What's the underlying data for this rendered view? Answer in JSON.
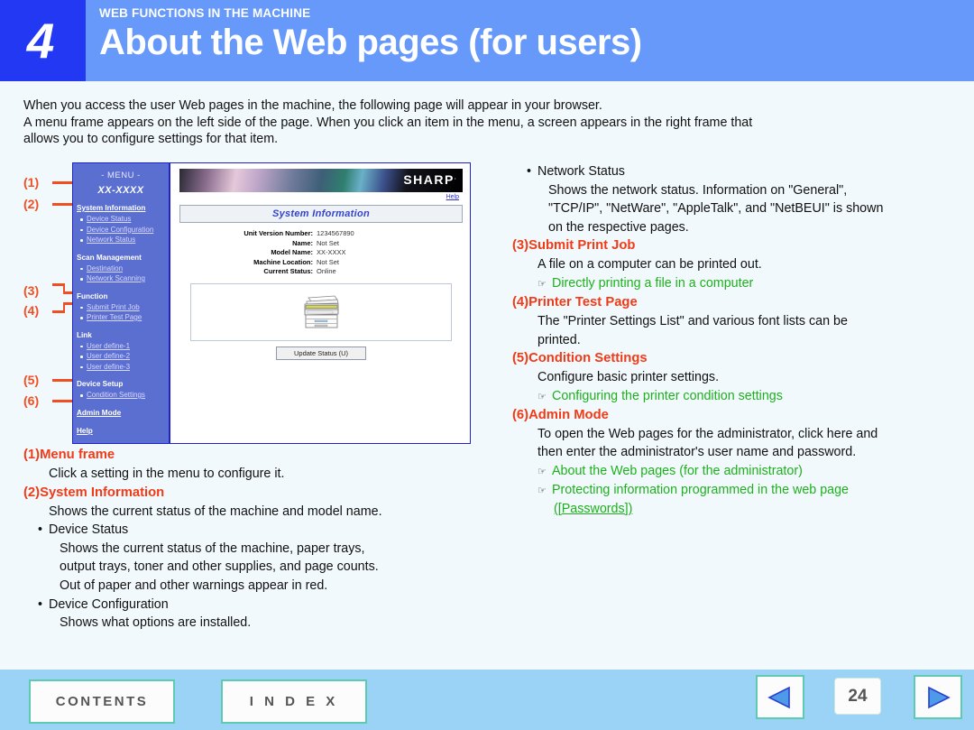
{
  "header": {
    "chapter_number": "4",
    "kicker": "WEB FUNCTIONS IN THE MACHINE",
    "title": "About the Web pages (for users)",
    "chapter_block_color": "#2338f2",
    "banner_color": "#6699fa"
  },
  "intro": {
    "line1": "When you access the user Web pages in the machine, the following page will appear in your browser.",
    "line2": "A menu frame appears on the left side of the page. When you click an item in the menu, a screen appears in the right frame that",
    "line3": "allows you to configure settings for that item."
  },
  "callouts": [
    {
      "label": "(1)"
    },
    {
      "label": "(2)"
    },
    {
      "label": "(3)"
    },
    {
      "label": "(4)"
    },
    {
      "label": "(5)"
    },
    {
      "label": "(6)"
    }
  ],
  "mockup": {
    "menu": {
      "title": "- MENU -",
      "model": "XX-XXXX",
      "groups": [
        {
          "head": "System Information",
          "head_is_link": true,
          "links": [
            "Device Status",
            "Device Configuration",
            "Network Status"
          ]
        },
        {
          "head": "Scan Management",
          "head_is_link": false,
          "links": [
            "Destination",
            "Network Scanning"
          ]
        },
        {
          "head": "Function",
          "head_is_link": false,
          "links": [
            "Submit Print Job",
            "Printer Test Page"
          ]
        },
        {
          "head": "Link",
          "head_is_link": false,
          "links": [
            "User define-1",
            "User define-2",
            "User define-3"
          ]
        },
        {
          "head": "Device Setup",
          "head_is_link": false,
          "links": [
            "Condition Settings"
          ]
        }
      ],
      "admin_mode": "Admin Mode",
      "help": "Help"
    },
    "main": {
      "brand": "SHARP",
      "brand_mark": ".",
      "help_link": "Help",
      "panel_title": "System Information",
      "fields": [
        {
          "label": "Unit Version Number:",
          "value": "1234567890"
        },
        {
          "label": "Name:",
          "value": "Not Set"
        },
        {
          "label": "Model Name:",
          "value": "XX-XXXX"
        },
        {
          "label": "Machine Location:",
          "value": "Not Set"
        },
        {
          "label": "Current Status:",
          "value": "Online"
        }
      ],
      "printer_icon": "multifunction-printer-icon",
      "update_button": "Update Status (U)"
    }
  },
  "left_body": {
    "s1_heading": "(1)Menu frame",
    "s1_text": "Click a setting in the menu to configure it.",
    "s2_heading": "(2)System Information",
    "s2_text": "Shows the current status of the machine and model name.",
    "s2_b1_title": "Device Status",
    "s2_b1_l1": "Shows the current status of the machine, paper trays,",
    "s2_b1_l2": "output trays, toner and other supplies, and page counts.",
    "s2_b1_l3": "Out of paper and other warnings appear in red.",
    "s2_b2_title": "Device Configuration",
    "s2_b2_l1": "Shows what options are installed."
  },
  "right_body": {
    "b3_title": "Network Status",
    "b3_l1": "Shows the network status. Information on \"General\",",
    "b3_l2": "\"TCP/IP\", \"NetWare\", \"AppleTalk\", and \"NetBEUI\" is shown",
    "b3_l3": "on the respective pages.",
    "s3_heading": "(3)Submit Print Job",
    "s3_text": "A file on a computer can be printed out.",
    "s3_link": "Directly printing a file in a computer",
    "s4_heading": "(4)Printer Test Page",
    "s4_l1": "The \"Printer Settings List\" and various font lists can be",
    "s4_l2": "printed.",
    "s5_heading": "(5)Condition Settings",
    "s5_text": "Configure basic printer settings.",
    "s5_link": "Configuring the printer condition settings",
    "s6_heading": "(6)Admin Mode",
    "s6_l1": "To open the Web pages for the administrator, click here and",
    "s6_l2": "then enter the administrator's user name and password.",
    "s6_link1": "About the Web pages (for the administrator)",
    "s6_link2": "Protecting information programmed in the web page ",
    "s6_link2_cont": "([Passwords])"
  },
  "footer": {
    "contents_label": "CONTENTS",
    "index_label": "I N D E X",
    "prev_icon": "previous-page-triangle-icon",
    "next_icon": "next-page-triangle-icon",
    "page_number": "24",
    "bar_color": "#9ad3f5",
    "button_border_color": "#5ecbb0"
  },
  "colors": {
    "heading_red": "#ef3b18",
    "link_green": "#1db11d",
    "callout_orange": "#f04e23",
    "page_background": "#f2f9fc"
  }
}
